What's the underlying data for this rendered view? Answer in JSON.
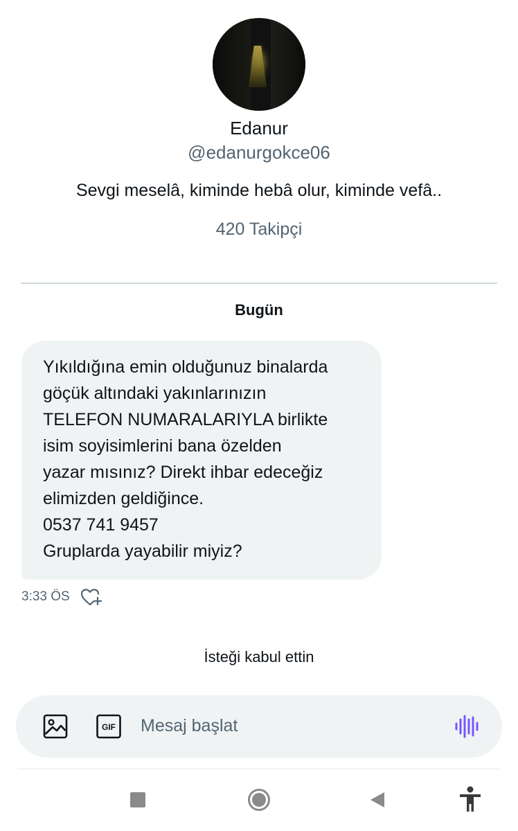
{
  "profile": {
    "name": "Edanur",
    "handle": "@edanurgokce06",
    "bio": "Sevgi meselâ, kiminde hebâ olur, kiminde vefâ..",
    "followers": "420 Takipçi"
  },
  "conversation": {
    "day_label": "Bugün",
    "message": {
      "lines": [
        "Yıkıldığına emin olduğunuz binalarda",
        "göçük altındaki yakınlarınızın",
        "TELEFON NUMARALARIYLA birlikte",
        "isim soyisimlerini bana özelden",
        "yazar mısınız? Direkt ihbar edeceğiz",
        "elimizden geldiğince.",
        "0537 741 9457",
        "Gruplarda yayabilir miyiz?"
      ],
      "time": "3:33 ÖS"
    },
    "status_text": "İsteği kabul ettin"
  },
  "composer": {
    "placeholder": "Mesaj başlat",
    "gif_label": "GIF",
    "accent_color": "#7856ff"
  },
  "icons": [
    "image-icon",
    "gif-icon",
    "voice-icon",
    "heart-plus-icon"
  ]
}
